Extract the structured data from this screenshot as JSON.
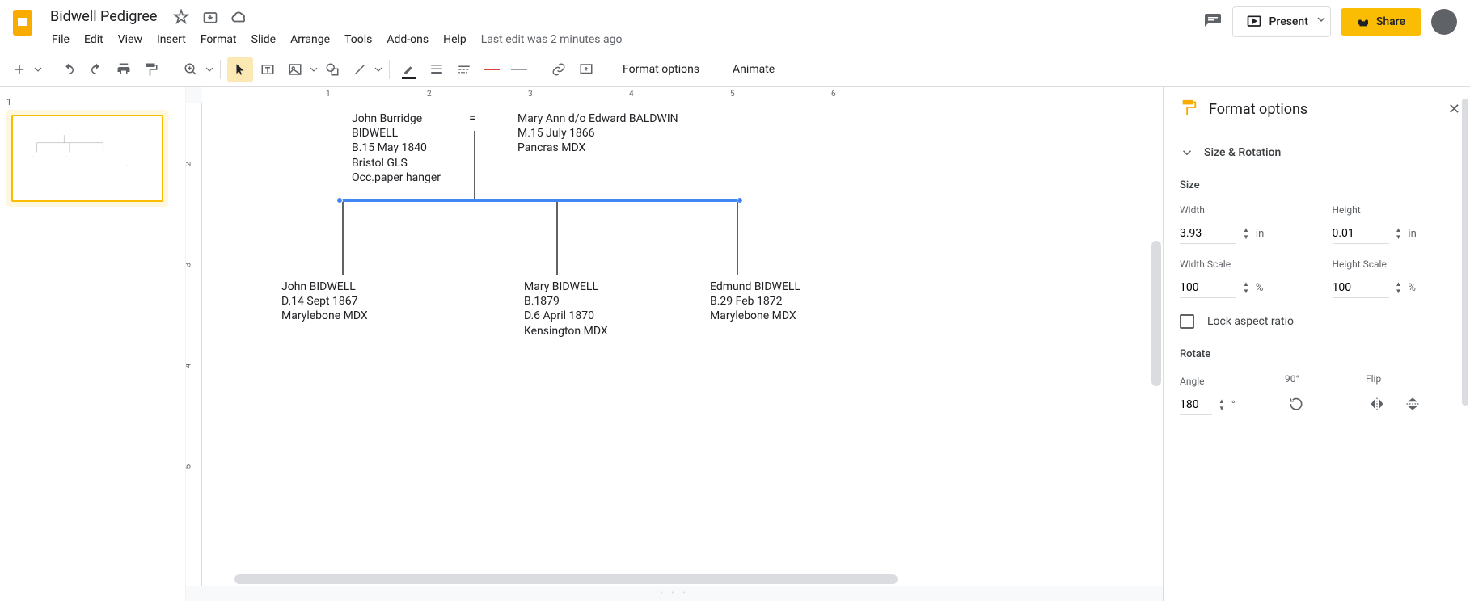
{
  "doc": {
    "title": "Bidwell Pedigree",
    "last_edit": "Last edit was 2 minutes ago"
  },
  "menubar": [
    "File",
    "Edit",
    "View",
    "Insert",
    "Format",
    "Slide",
    "Arrange",
    "Tools",
    "Add-ons",
    "Help"
  ],
  "titlebar_actions": {
    "present": "Present",
    "share": "Share"
  },
  "toolbar": {
    "format_options": "Format options",
    "animate": "Animate"
  },
  "ruler_h": [
    "1",
    "2",
    "3",
    "4",
    "5",
    "6"
  ],
  "ruler_v": [
    "2",
    "3",
    "4",
    "5"
  ],
  "filmstrip": {
    "slide_number": "1"
  },
  "pedigree": {
    "father": "John Burridge\nBIDWELL\nB.15 May 1840\nBristol GLS\nOcc.paper hanger",
    "equals": "=",
    "mother": "Mary Ann d/o Edward BALDWIN\nM.15 July 1866\nPancras MDX",
    "child1": "John BIDWELL\nD.14 Sept 1867\nMarylebone MDX",
    "child2": "Mary BIDWELL\nB.1879\nD.6 April 1870\nKensington MDX",
    "child3": "Edmund BIDWELL\nB.29 Feb 1872\nMarylebone MDX"
  },
  "sidebar": {
    "title": "Format options",
    "section": "Size & Rotation",
    "size_head": "Size",
    "width_label": "Width",
    "height_label": "Height",
    "width_val": "3.93",
    "height_val": "0.01",
    "unit_in": "in",
    "width_scale_label": "Width Scale",
    "height_scale_label": "Height Scale",
    "width_scale_val": "100",
    "height_scale_val": "100",
    "unit_pct": "%",
    "lock_label": "Lock aspect ratio",
    "rotate_head": "Rotate",
    "angle_label": "Angle",
    "angle_val": "180",
    "deg": "°",
    "ninety_label": "90°",
    "flip_label": "Flip"
  }
}
